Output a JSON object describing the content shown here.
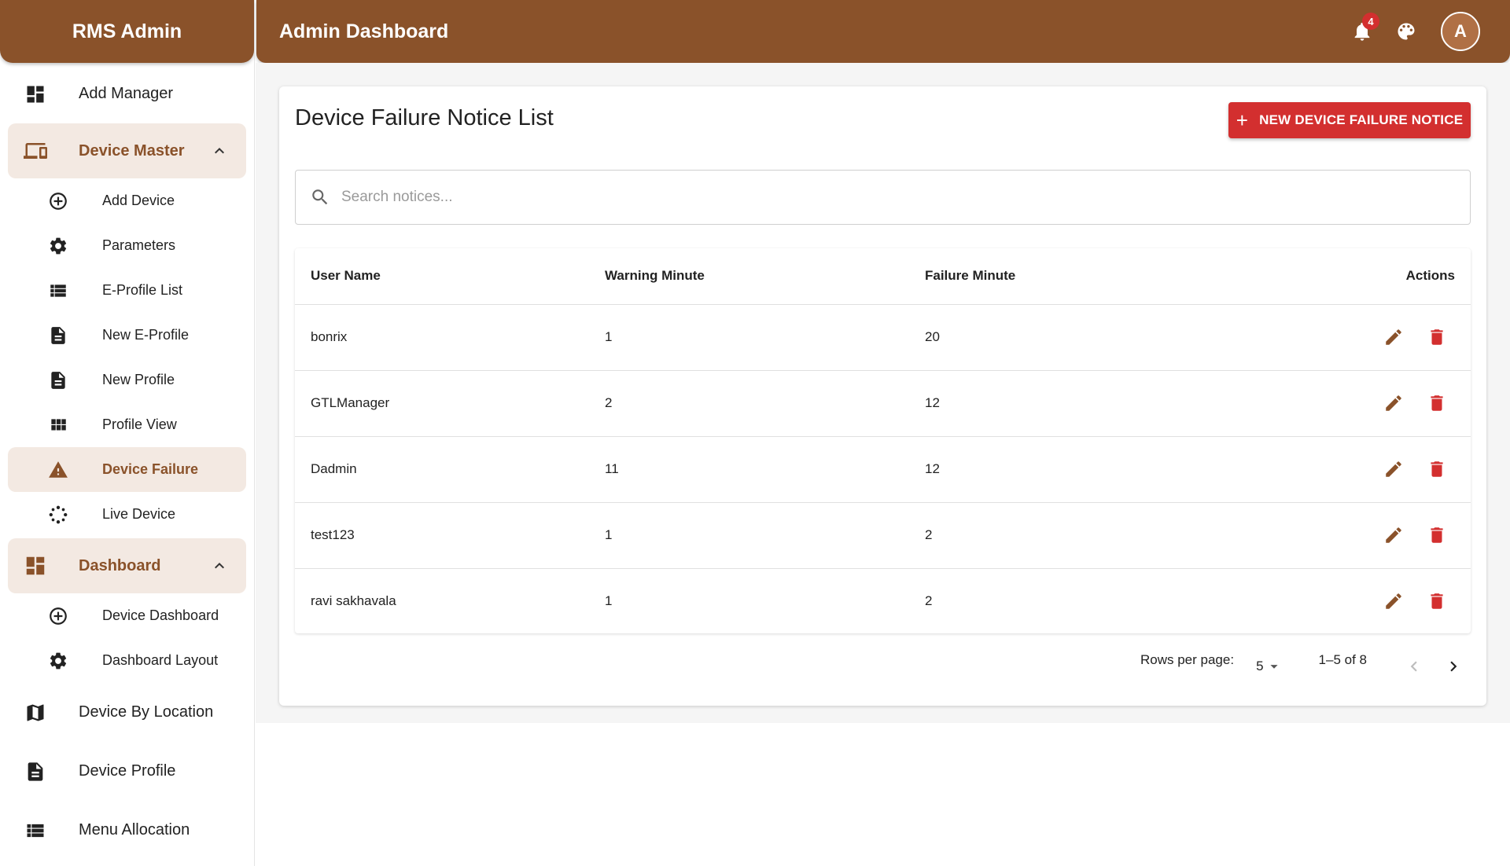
{
  "brand": "RMS Admin",
  "topbar": {
    "title": "Admin Dashboard",
    "notification_count": "4",
    "notification_icon": "bell-icon",
    "theme_icon": "palette-icon",
    "avatar_initial": "A"
  },
  "sidebar": {
    "add_manager": "Add Manager",
    "device_master": {
      "label": "Device Master",
      "expanded": true,
      "items": [
        {
          "label": "Add Device",
          "icon": "add-circle-icon"
        },
        {
          "label": "Parameters",
          "icon": "gear-icon"
        },
        {
          "label": "E-Profile List",
          "icon": "list-icon"
        },
        {
          "label": "New E-Profile",
          "icon": "document-icon"
        },
        {
          "label": "New Profile",
          "icon": "document-icon"
        },
        {
          "label": "Profile View",
          "icon": "grid-icon"
        },
        {
          "label": "Device Failure",
          "icon": "warning-icon",
          "active": true
        },
        {
          "label": "Live Device",
          "icon": "spinner-icon"
        }
      ]
    },
    "dashboard": {
      "label": "Dashboard",
      "expanded": true,
      "items": [
        {
          "label": "Device Dashboard",
          "icon": "add-circle-icon"
        },
        {
          "label": "Dashboard Layout",
          "icon": "gear-icon"
        }
      ]
    },
    "device_by_location": "Device By Location",
    "device_profile": "Device Profile",
    "menu_allocation": "Menu Allocation"
  },
  "main": {
    "title": "Device Failure Notice List",
    "new_button": "NEW DEVICE FAILURE NOTICE",
    "search_placeholder": "Search notices...",
    "columns": {
      "user": "User Name",
      "warning": "Warning Minute",
      "failure": "Failure Minute",
      "actions": "Actions"
    },
    "rows": [
      {
        "user": "bonrix",
        "warning": "1",
        "failure": "20"
      },
      {
        "user": "GTLManager",
        "warning": "2",
        "failure": "12"
      },
      {
        "user": "Dadmin",
        "warning": "11",
        "failure": "12"
      },
      {
        "user": "test123",
        "warning": "1",
        "failure": "2"
      },
      {
        "user": "ravi sakhavala",
        "warning": "1",
        "failure": "2"
      }
    ],
    "pagination": {
      "rows_per_page_label": "Rows per page:",
      "rows_per_page": "5",
      "range": "1–5 of 8"
    }
  },
  "colors": {
    "brand": "#8a522a",
    "accent_bg": "#f3e9e2",
    "danger": "#d32f2f"
  }
}
